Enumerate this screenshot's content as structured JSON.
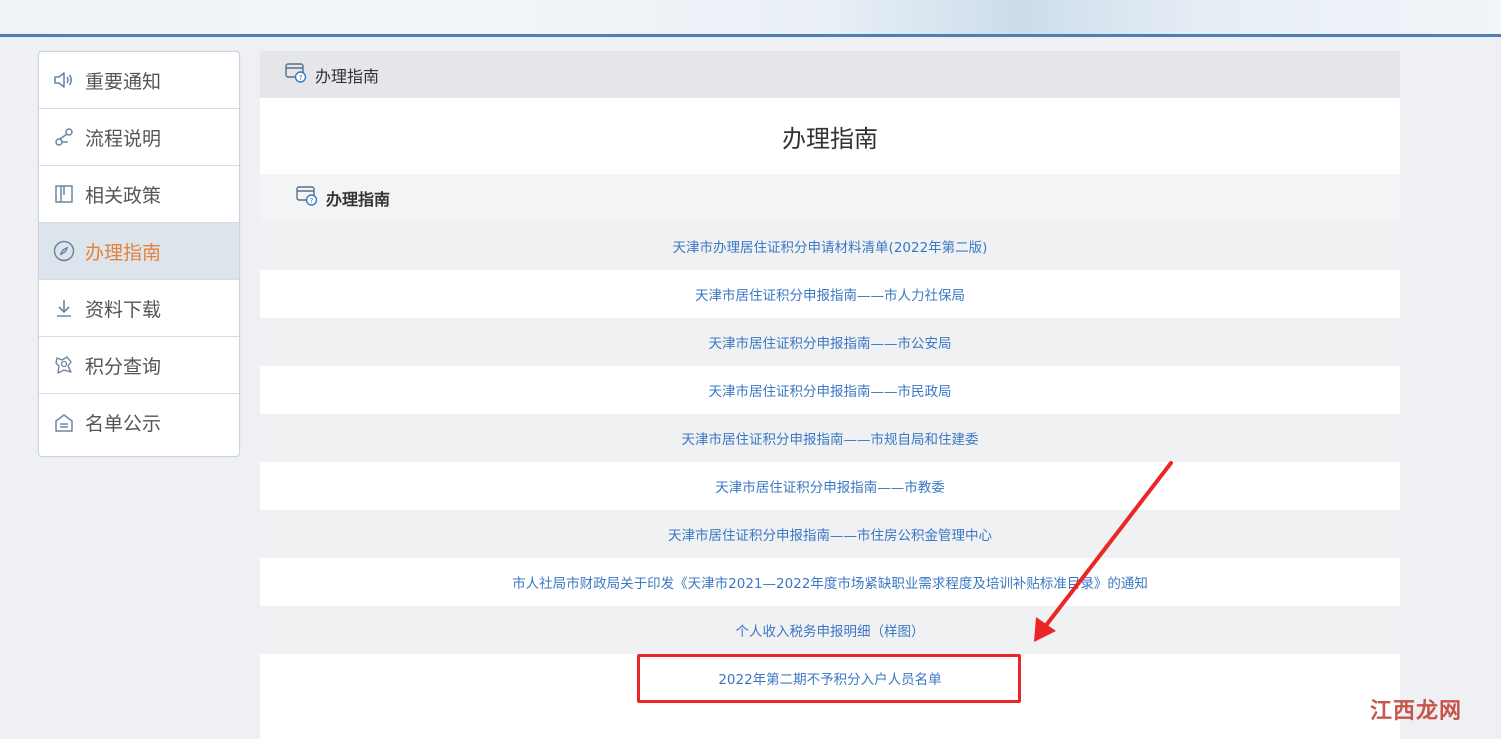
{
  "sidebar": {
    "items": [
      {
        "label": "重要通知",
        "icon": "speaker-icon"
      },
      {
        "label": "流程说明",
        "icon": "flow-icon"
      },
      {
        "label": "相关政策",
        "icon": "book-icon"
      },
      {
        "label": "办理指南",
        "icon": "compass-icon",
        "active": true
      },
      {
        "label": "资料下载",
        "icon": "download-icon"
      },
      {
        "label": "积分查询",
        "icon": "search-points-icon"
      },
      {
        "label": "名单公示",
        "icon": "building-icon"
      }
    ]
  },
  "main": {
    "header_label": "办理指南",
    "title": "办理指南",
    "section_label": "办理指南",
    "items": [
      "天津市办理居住证积分申请材料清单(2022年第二版)",
      "天津市居住证积分申报指南——市人力社保局",
      "天津市居住证积分申报指南——市公安局",
      "天津市居住证积分申报指南——市民政局",
      "天津市居住证积分申报指南——市规自局和住建委",
      "天津市居住证积分申报指南——市教委",
      "天津市居住证积分申报指南——市住房公积金管理中心",
      "市人社局市财政局关于印发《天津市2021—2022年度市场紧缺职业需求程度及培训补贴标准目录》的通知",
      "个人收入税务申报明细（样图）",
      "2022年第二期不予积分入户人员名单"
    ]
  },
  "watermark": "江西龙网",
  "colors": {
    "accent": "#4d7fb3",
    "link": "#3b78c4",
    "active_label": "#e5813a",
    "highlight": "#ea2626"
  }
}
